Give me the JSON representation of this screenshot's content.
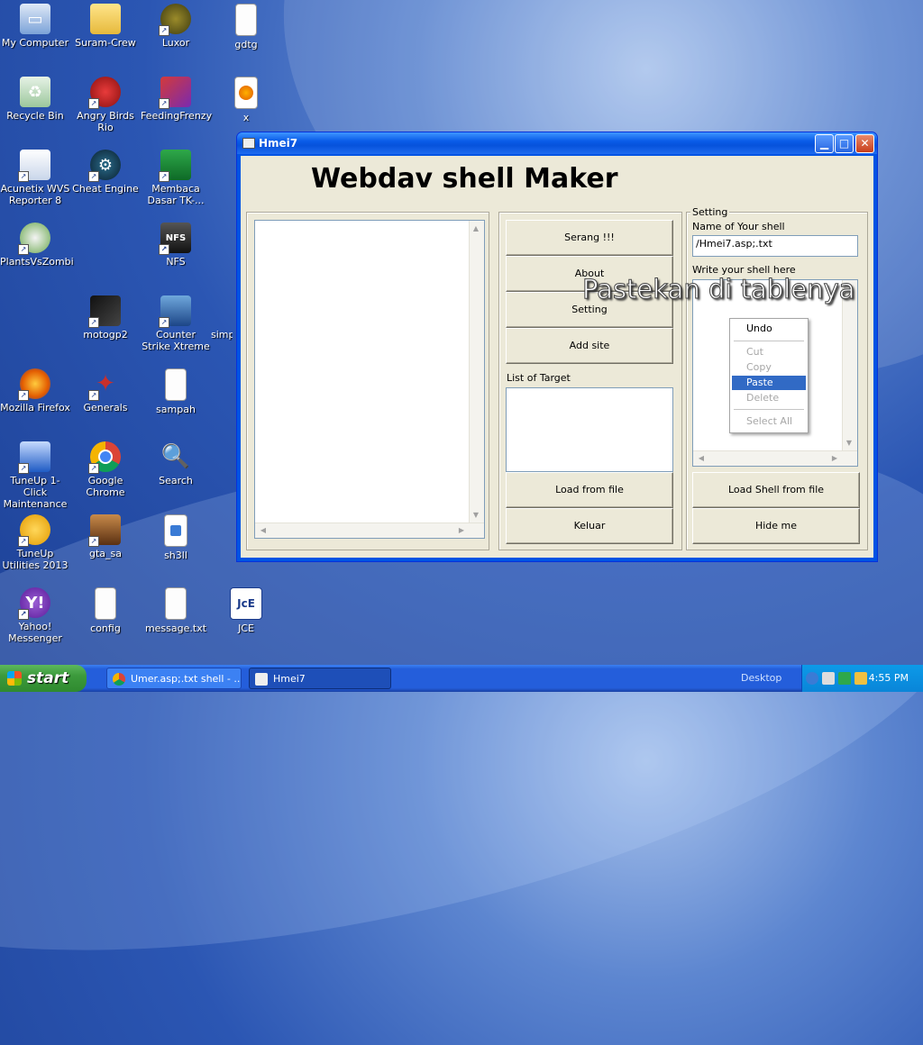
{
  "desktop": {
    "icons": [
      {
        "label": "My Computer",
        "icon": "my-computer-icon"
      },
      {
        "label": "Suram-Crew",
        "icon": "folder-icon"
      },
      {
        "label": "Luxor",
        "icon": "luxor-icon"
      },
      {
        "label": "gdtg",
        "icon": "text-file-icon"
      },
      {
        "label": "Recycle Bin",
        "icon": "recycle-bin-icon"
      },
      {
        "label": "Angry Birds Rio",
        "icon": "angry-birds-icon"
      },
      {
        "label": "FeedingFrenzy",
        "icon": "feedingfrenzy-icon"
      },
      {
        "label": "x",
        "icon": "firefox-file-icon"
      },
      {
        "label": "Acunetix WVS Reporter 8",
        "icon": "acunetix-icon"
      },
      {
        "label": "Cheat Engine",
        "icon": "cheat-engine-icon"
      },
      {
        "label": "Membaca Dasar TK-...",
        "icon": "membaca-icon"
      },
      {
        "label": "PlantsVsZombi",
        "icon": "plants-vs-zombies-icon"
      },
      {
        "label": "NFS",
        "icon": "nfs-icon"
      },
      {
        "label": "motogp2",
        "icon": "motogp-icon"
      },
      {
        "label": "Counter Strike Xtreme",
        "icon": "counter-strike-icon"
      },
      {
        "label": "simp",
        "icon": "simp-icon"
      },
      {
        "label": "Mozilla Firefox",
        "icon": "firefox-icon"
      },
      {
        "label": "Generals",
        "icon": "generals-icon"
      },
      {
        "label": "sampah",
        "icon": "text-file-icon"
      },
      {
        "label": "TuneUp 1-Click Maintenance",
        "icon": "tuneup-icon"
      },
      {
        "label": "Google Chrome",
        "icon": "chrome-icon"
      },
      {
        "label": "Search",
        "icon": "search-icon"
      },
      {
        "label": "TuneUp Utilities 2013",
        "icon": "tuneup-utilities-icon"
      },
      {
        "label": "gta_sa",
        "icon": "gta-icon"
      },
      {
        "label": "sh3ll",
        "icon": "file-icon"
      },
      {
        "label": "Yahoo! Messenger",
        "icon": "yahoo-messenger-icon"
      },
      {
        "label": "config",
        "icon": "text-file-icon"
      },
      {
        "label": "message.txt",
        "icon": "text-file-icon"
      },
      {
        "label": "JCE",
        "icon": "jce-icon"
      }
    ]
  },
  "window": {
    "title": "Hmei7",
    "heading": "Webdav shell Maker",
    "buttons": {
      "serang": "Serang !!!",
      "about": "About",
      "setting": "Setting",
      "add_site": "Add site",
      "load_from_file": "Load from file",
      "keluar": "Keluar",
      "load_shell": "Load Shell from file",
      "hide_me": "Hide me"
    },
    "list_of_target_label": "List of Target",
    "setting_group": "Setting",
    "shell_name_label": "Name of Your shell",
    "shell_name_value": "/Hmei7.asp;.txt",
    "write_shell_label": "Write your shell here"
  },
  "context_menu": {
    "undo": "Undo",
    "cut": "Cut",
    "copy": "Copy",
    "paste": "Paste",
    "delete": "Delete",
    "select_all": "Select All"
  },
  "overlay_text": "Pastekan di tablenya",
  "taskbar": {
    "start": "start",
    "items": [
      "Umer.asp;.txt shell - ...",
      "Hmei7"
    ],
    "desktop": "Desktop",
    "clock": "4:55 PM"
  }
}
